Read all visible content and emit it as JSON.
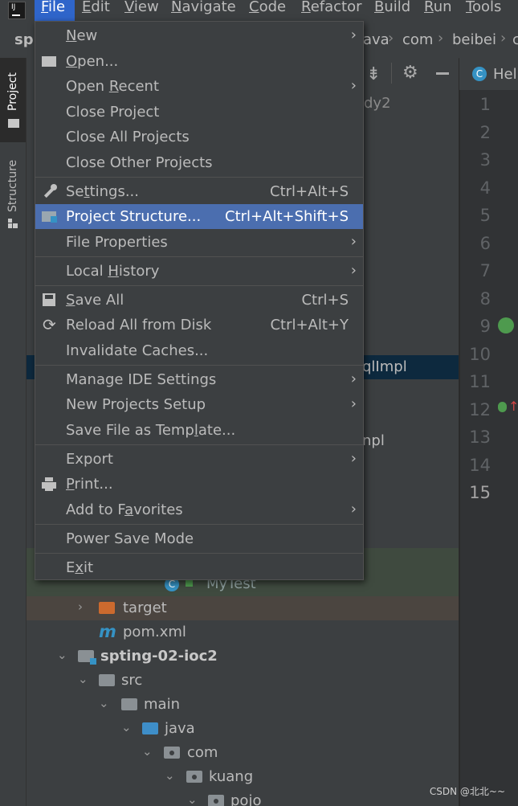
{
  "menubar": {
    "items": [
      {
        "label": "File",
        "mnemonic": "F",
        "rest": "ile"
      },
      {
        "label": "Edit",
        "mnemonic": "E",
        "rest": "dit"
      },
      {
        "label": "View",
        "mnemonic": "V",
        "rest": "iew"
      },
      {
        "label": "Navigate",
        "mnemonic": "N",
        "rest": "avigate"
      },
      {
        "label": "Code",
        "mnemonic": "C",
        "rest": "ode"
      },
      {
        "label": "Refactor",
        "mnemonic": "R",
        "rest": "efactor"
      },
      {
        "label": "Build",
        "mnemonic": "B",
        "rest": "uild"
      },
      {
        "label": "Run",
        "mnemonic": "R",
        "rest": "un"
      },
      {
        "label": "Tools",
        "mnemonic": "T",
        "rest": "ools"
      }
    ],
    "active": "File"
  },
  "navbar": {
    "project_partial": "spr",
    "crumbs": [
      "ava",
      "com",
      "beibei",
      "c"
    ]
  },
  "toolstrip": {
    "tabs": [
      {
        "label": "Project",
        "icon": "folder-icon"
      },
      {
        "label": "Structure",
        "icon": "structure-icon"
      }
    ]
  },
  "project_tree": {
    "partial_texts": {
      "study": "dy2",
      "service_impl": "qlImpl",
      "impl2": "npl"
    },
    "rows": [
      {
        "label": "MyTest",
        "icon": "class-icon"
      },
      {
        "label": "target",
        "icon": "folder-icon"
      },
      {
        "label": "pom.xml",
        "icon": "maven-icon"
      },
      {
        "label": "spting-02-ioc2",
        "icon": "module-folder-icon"
      },
      {
        "label": "src",
        "icon": "folder-icon"
      },
      {
        "label": "main",
        "icon": "folder-icon"
      },
      {
        "label": "java",
        "icon": "source-folder-icon"
      },
      {
        "label": "com",
        "icon": "package-icon"
      },
      {
        "label": "kuang",
        "icon": "package-icon"
      },
      {
        "label": "pojo",
        "icon": "package-icon"
      }
    ]
  },
  "editor": {
    "tab_label": "Hel",
    "line_numbers": [
      "1",
      "2",
      "3",
      "4",
      "5",
      "6",
      "7",
      "8",
      "9",
      "10",
      "11",
      "12",
      "13",
      "14",
      "15"
    ],
    "current_line": "15"
  },
  "file_menu": {
    "items": [
      {
        "label": "New",
        "pre": "",
        "mn": "N",
        "post": "ew",
        "shortcut": "",
        "submenu": true,
        "icon": ""
      },
      {
        "label": "Open...",
        "pre": "",
        "mn": "O",
        "post": "pen...",
        "shortcut": "",
        "submenu": false,
        "icon": "open-folder-icon"
      },
      {
        "label": "Open Recent",
        "pre": "Open ",
        "mn": "R",
        "post": "ecent",
        "shortcut": "",
        "submenu": true,
        "icon": ""
      },
      {
        "label": "Close Project",
        "pre": "Close Project",
        "mn": "",
        "post": "",
        "shortcut": "",
        "submenu": false,
        "icon": ""
      },
      {
        "label": "Close All Projects",
        "pre": "Close All Projects",
        "mn": "",
        "post": "",
        "shortcut": "",
        "submenu": false,
        "icon": ""
      },
      {
        "label": "Close Other Projects",
        "pre": "Close Other Projects",
        "mn": "",
        "post": "",
        "shortcut": "",
        "submenu": false,
        "icon": ""
      },
      {
        "label": "Settings...",
        "pre": "Se",
        "mn": "t",
        "post": "tings...",
        "shortcut": "Ctrl+Alt+S",
        "submenu": false,
        "icon": "wrench-icon"
      },
      {
        "label": "Project Structure...",
        "pre": "Project Structure...",
        "mn": "",
        "post": "",
        "shortcut": "Ctrl+Alt+Shift+S",
        "submenu": false,
        "icon": "project-structure-icon"
      },
      {
        "label": "File Properties",
        "pre": "File Properties",
        "mn": "",
        "post": "",
        "shortcut": "",
        "submenu": true,
        "icon": ""
      },
      {
        "label": "Local History",
        "pre": "Local ",
        "mn": "H",
        "post": "istory",
        "shortcut": "",
        "submenu": true,
        "icon": ""
      },
      {
        "label": "Save All",
        "pre": "",
        "mn": "S",
        "post": "ave All",
        "shortcut": "Ctrl+S",
        "submenu": false,
        "icon": "save-icon"
      },
      {
        "label": "Reload All from Disk",
        "pre": "Reload All from Disk",
        "mn": "",
        "post": "",
        "shortcut": "Ctrl+Alt+Y",
        "submenu": false,
        "icon": "reload-icon"
      },
      {
        "label": "Invalidate Caches...",
        "pre": "Invalidate Caches...",
        "mn": "",
        "post": "",
        "shortcut": "",
        "submenu": false,
        "icon": ""
      },
      {
        "label": "Manage IDE Settings",
        "pre": "Manage IDE Settings",
        "mn": "",
        "post": "",
        "shortcut": "",
        "submenu": true,
        "icon": ""
      },
      {
        "label": "New Projects Setup",
        "pre": "New Projects Setup",
        "mn": "",
        "post": "",
        "shortcut": "",
        "submenu": true,
        "icon": ""
      },
      {
        "label": "Save File as Template...",
        "pre": "Save File as Temp",
        "mn": "l",
        "post": "ate...",
        "shortcut": "",
        "submenu": false,
        "icon": ""
      },
      {
        "label": "Export",
        "pre": "Export",
        "mn": "",
        "post": "",
        "shortcut": "",
        "submenu": true,
        "icon": ""
      },
      {
        "label": "Print...",
        "pre": "",
        "mn": "P",
        "post": "rint...",
        "shortcut": "",
        "submenu": false,
        "icon": "print-icon"
      },
      {
        "label": "Add to Favorites",
        "pre": "Add to F",
        "mn": "a",
        "post": "vorites",
        "shortcut": "",
        "submenu": true,
        "icon": ""
      },
      {
        "label": "Power Save Mode",
        "pre": "Power Save Mode",
        "mn": "",
        "post": "",
        "shortcut": "",
        "submenu": false,
        "icon": ""
      },
      {
        "label": "Exit",
        "pre": "E",
        "mn": "x",
        "post": "it",
        "shortcut": "",
        "submenu": false,
        "icon": ""
      }
    ],
    "selected": "Project Structure..."
  },
  "watermark": "CSDN @北北~~",
  "colors": {
    "menu_bg": "#3c3f41",
    "selection": "#4b6eaf",
    "menubar_active": "#2f65ca",
    "editor_bg": "#2b2b2b"
  }
}
